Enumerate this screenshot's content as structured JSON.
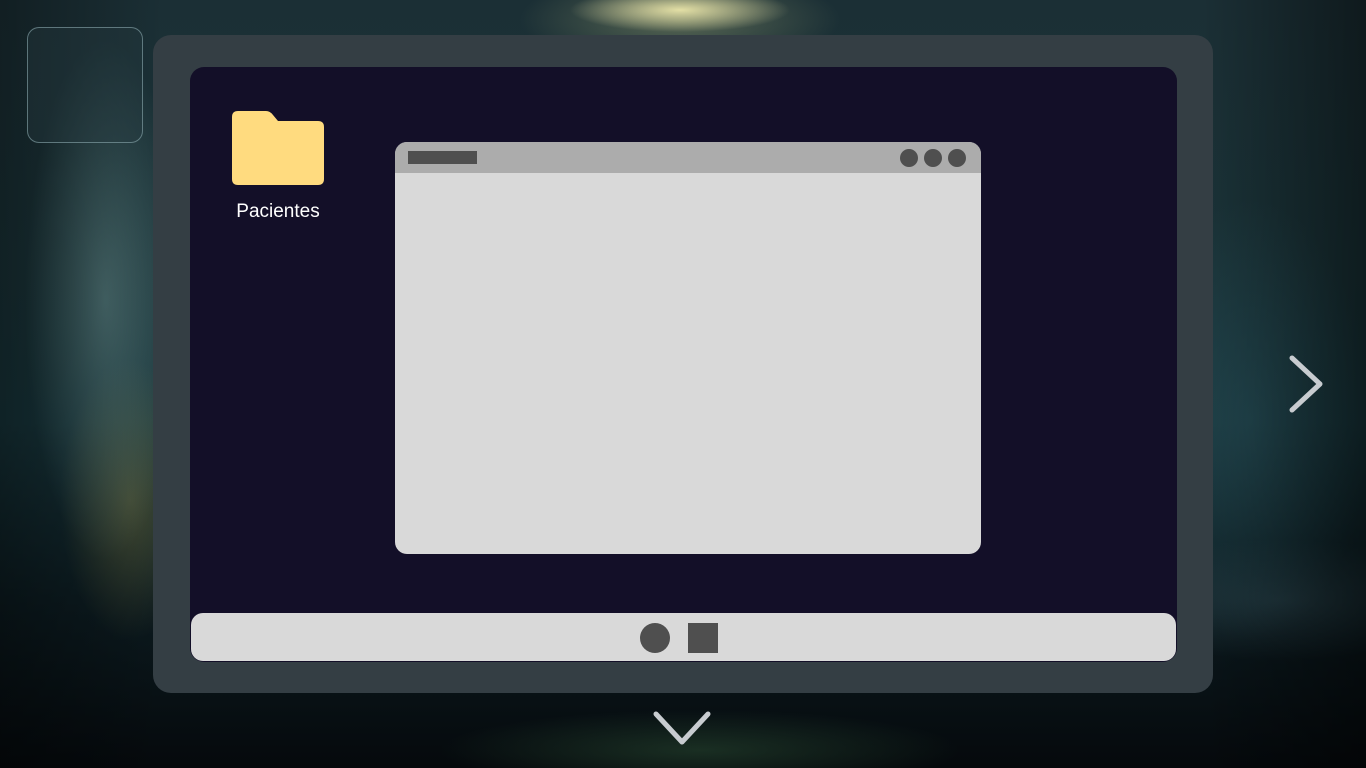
{
  "desktop": {
    "folders": [
      {
        "label": "Pacientes",
        "icon": "folder-icon",
        "color": "#ffdb7f"
      }
    ]
  },
  "app_window": {
    "title": "",
    "controls": [
      "window-control",
      "window-control",
      "window-control"
    ]
  },
  "taskbar": {
    "buttons": [
      {
        "icon": "home-circle-icon"
      },
      {
        "icon": "recent-apps-square-icon"
      }
    ]
  },
  "navigation": {
    "next_icon": "chevron-right-icon",
    "close_icon": "chevron-down-icon"
  },
  "colors": {
    "device_frame": "#343e44",
    "screen_background": "#130f28",
    "window_body": "#d9d9d9",
    "window_titlebar": "#acacac",
    "controls": "#4f4f4f",
    "folder": "#ffdb7f",
    "arrows": "#c8ccd0"
  }
}
